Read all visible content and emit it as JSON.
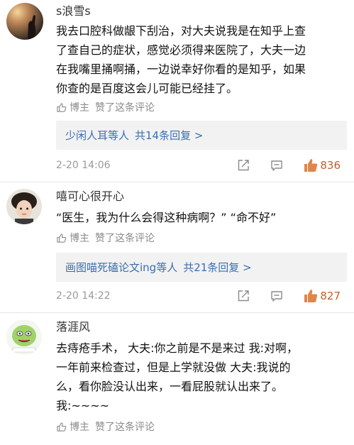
{
  "comments": [
    {
      "username": "s浪雪s",
      "lines": [
        "我去口腔科做龈下刮治，对大夫说我是在知乎上查",
        "了查自己的症状，感觉必须得来医院了，大夫一边",
        "在我嘴里捅啊捅，一边说幸好你看的是知乎，如果",
        "你查的是百度这会儿可能已经挂了。"
      ],
      "liked_by_label": "博主",
      "liked_text": "赞了这条评论",
      "reply_label": "少闲人耳等人",
      "reply_count": "共14条回复 >",
      "timestamp": "2-20 14:06",
      "likes": "836"
    },
    {
      "username": "嘻可心很开心",
      "lines": [
        "“医生，我为什么会得这种病啊？” “命不好”"
      ],
      "liked_by_label": "博主",
      "liked_text": "赞了这条评论",
      "reply_label": "画图喵死磕论文ing等人",
      "reply_count": "共21条回复 >",
      "timestamp": "2-20 14:22",
      "likes": "827"
    },
    {
      "username": "落涯风",
      "lines": [
        "去痔疮手术， 大夫:你之前是不是来过 我:对啊，",
        "一年前来检查过，但是上学就没做 大夫:我说的",
        "么，看你脸没认出来，一看屁股就认出来了。",
        "我:~~~~"
      ],
      "liked_by_label": "博主",
      "liked_text": "赞了这条评论"
    }
  ],
  "colors": {
    "link": "#3a6fb0",
    "like_accent": "#e0864a",
    "meta": "#9a9a9a"
  },
  "icons": [
    "thumb-up-outline-icon",
    "share-icon",
    "comment-icon",
    "thumb-up-filled-icon"
  ]
}
